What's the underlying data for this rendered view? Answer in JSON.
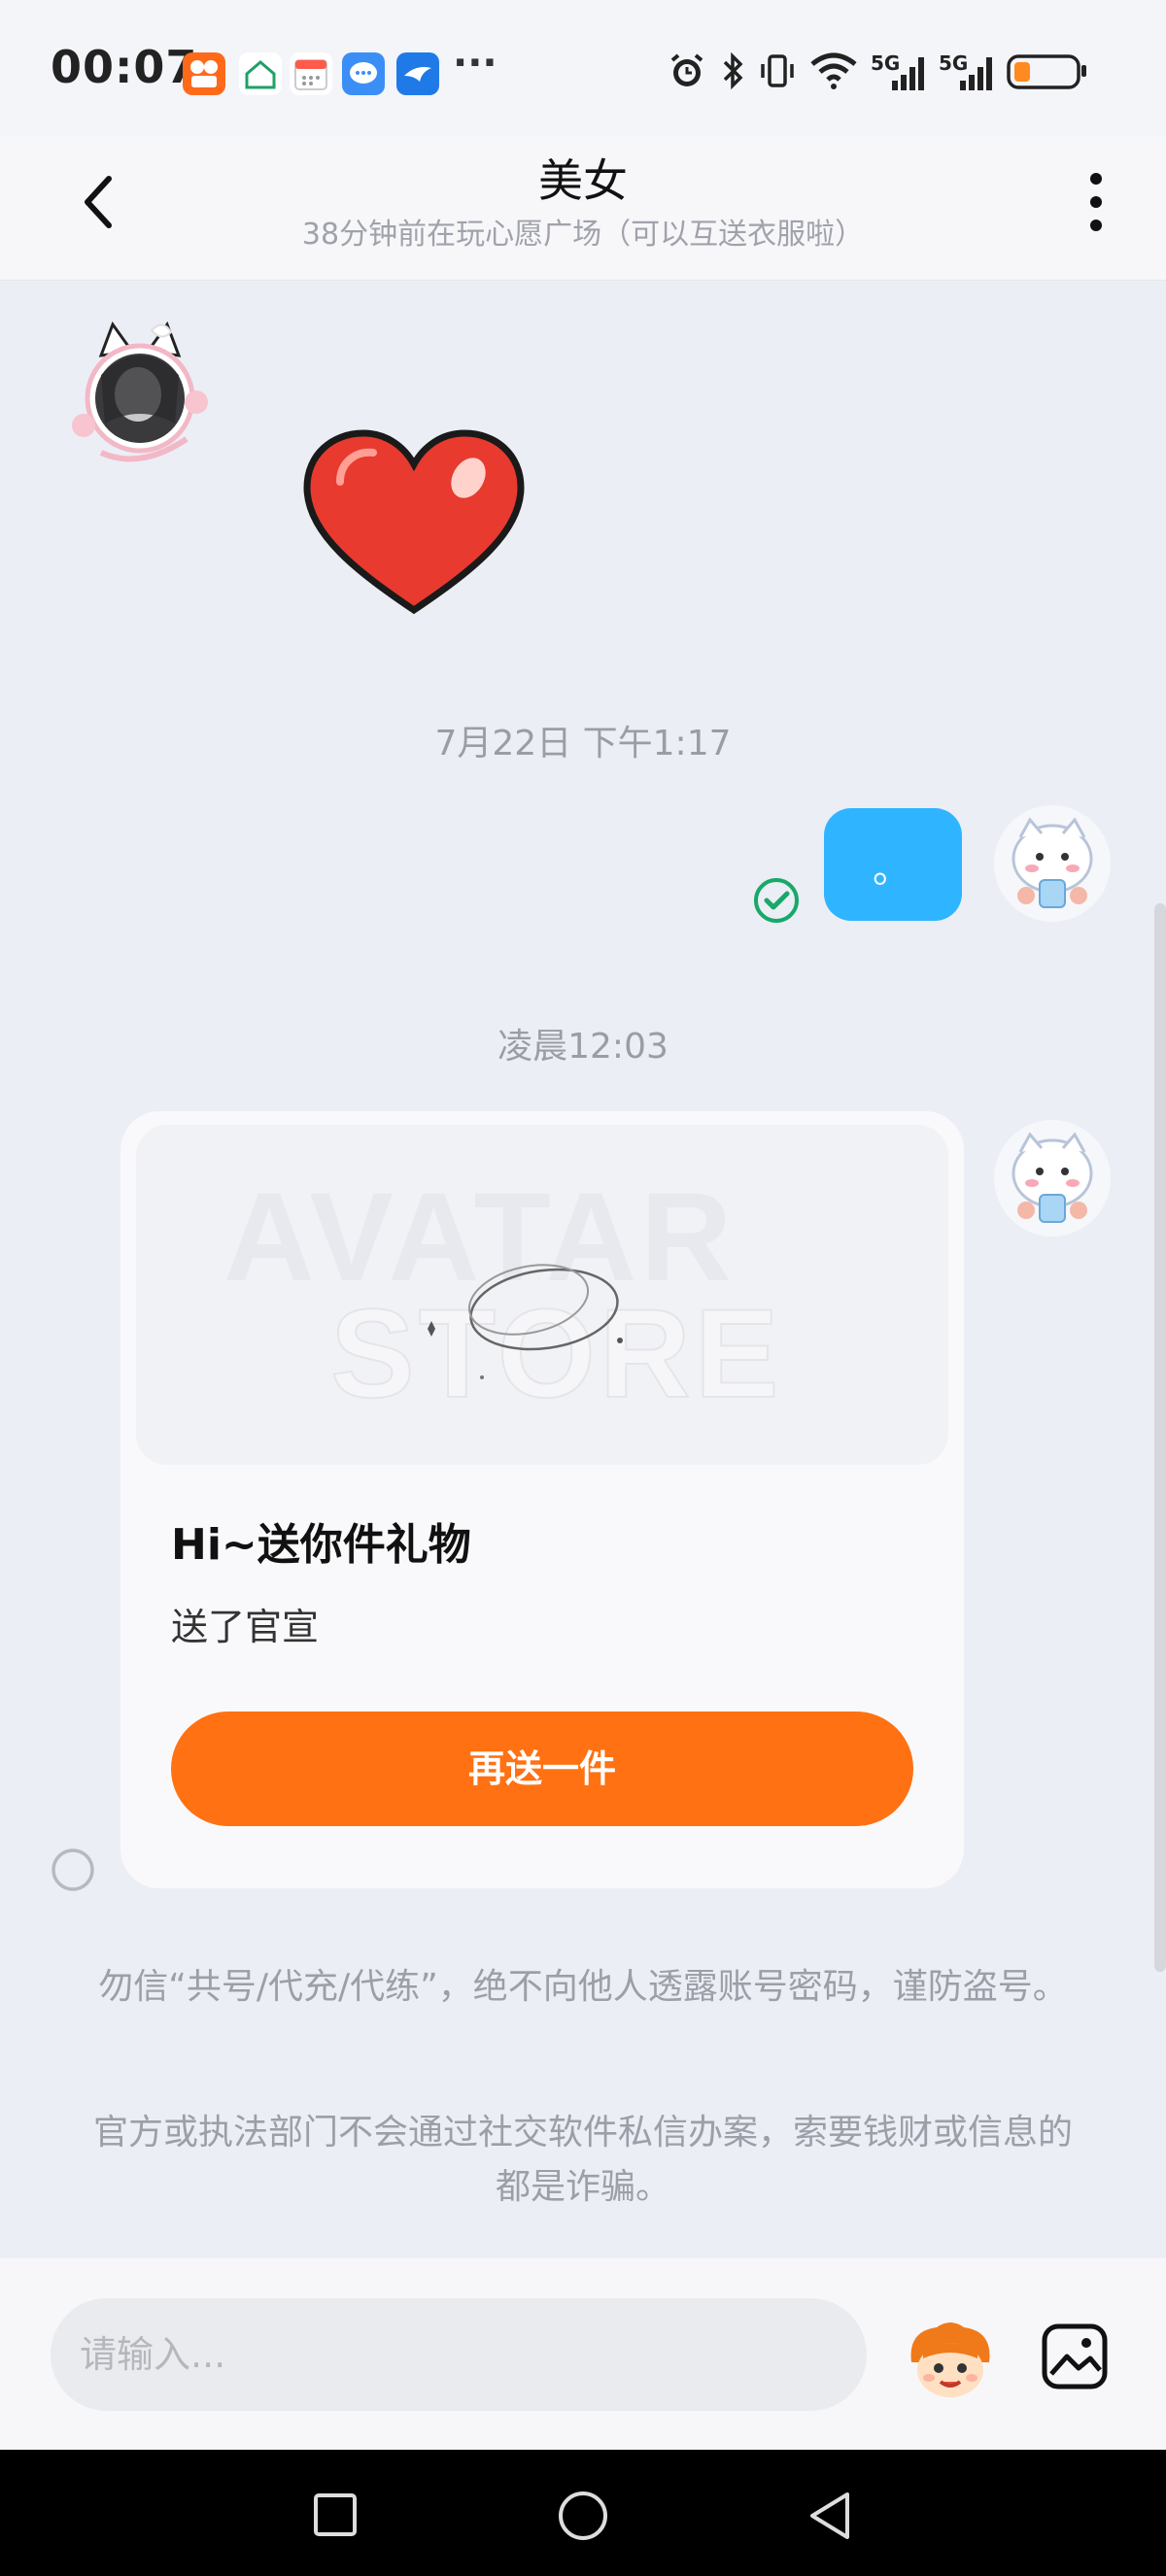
{
  "status_bar": {
    "time": "00:07",
    "network_1": "5G",
    "network_2": "5G",
    "more_dots": "···"
  },
  "header": {
    "title": "美女",
    "subtitle": "38分钟前在玩心愿广场（可以互送衣服啦）"
  },
  "chat": {
    "timestamp_1": "7月22日 下午1:17",
    "sent_message_text": "。",
    "timestamp_2": "凌晨12:03",
    "gift_card": {
      "watermark_line1": "AVATAR",
      "watermark_line2": "STORE",
      "title": "Hi~送你件礼物",
      "description": "送了官宣",
      "button_label": "再送一件"
    },
    "notice_1": "勿信“共号/代充/代练”，绝不向他人透露账号密码，谨防盗号。",
    "notice_2": "官方或执法部门不会通过社交软件私信办案，索要钱财或信息的都是诈骗。"
  },
  "input_bar": {
    "placeholder": "请输入..."
  },
  "colors": {
    "accent_orange": "#ff7112",
    "bubble_blue": "#2fb5ff",
    "check_green": "#19a86a"
  }
}
